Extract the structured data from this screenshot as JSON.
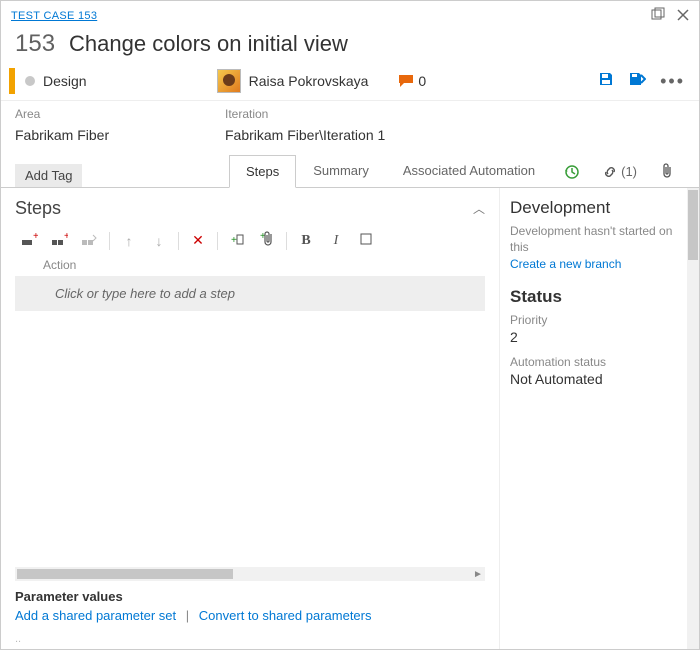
{
  "breadcrumb": "TEST CASE 153",
  "id": "153",
  "title": "Change colors on initial view",
  "state": "Design",
  "assignee": "Raisa Pokrovskaya",
  "discussion_count": "0",
  "fields": {
    "area_label": "Area",
    "area_value": "Fabrikam Fiber",
    "iteration_label": "Iteration",
    "iteration_value": "Fabrikam Fiber\\Iteration 1"
  },
  "add_tag_label": "Add Tag",
  "tabs": {
    "steps": "Steps",
    "summary": "Summary",
    "automation": "Associated Automation",
    "links_count": "(1)"
  },
  "steps_section": {
    "title": "Steps",
    "action_header": "Action",
    "placeholder": "Click or type here to add a step"
  },
  "parameters": {
    "title": "Parameter values",
    "add_shared": "Add a shared parameter set",
    "convert": "Convert to shared parameters"
  },
  "development": {
    "title": "Development",
    "text": "Development hasn't started on this",
    "link": "Create a new branch"
  },
  "status": {
    "title": "Status",
    "priority_label": "Priority",
    "priority_value": "2",
    "automation_label": "Automation status",
    "automation_value": "Not Automated"
  }
}
